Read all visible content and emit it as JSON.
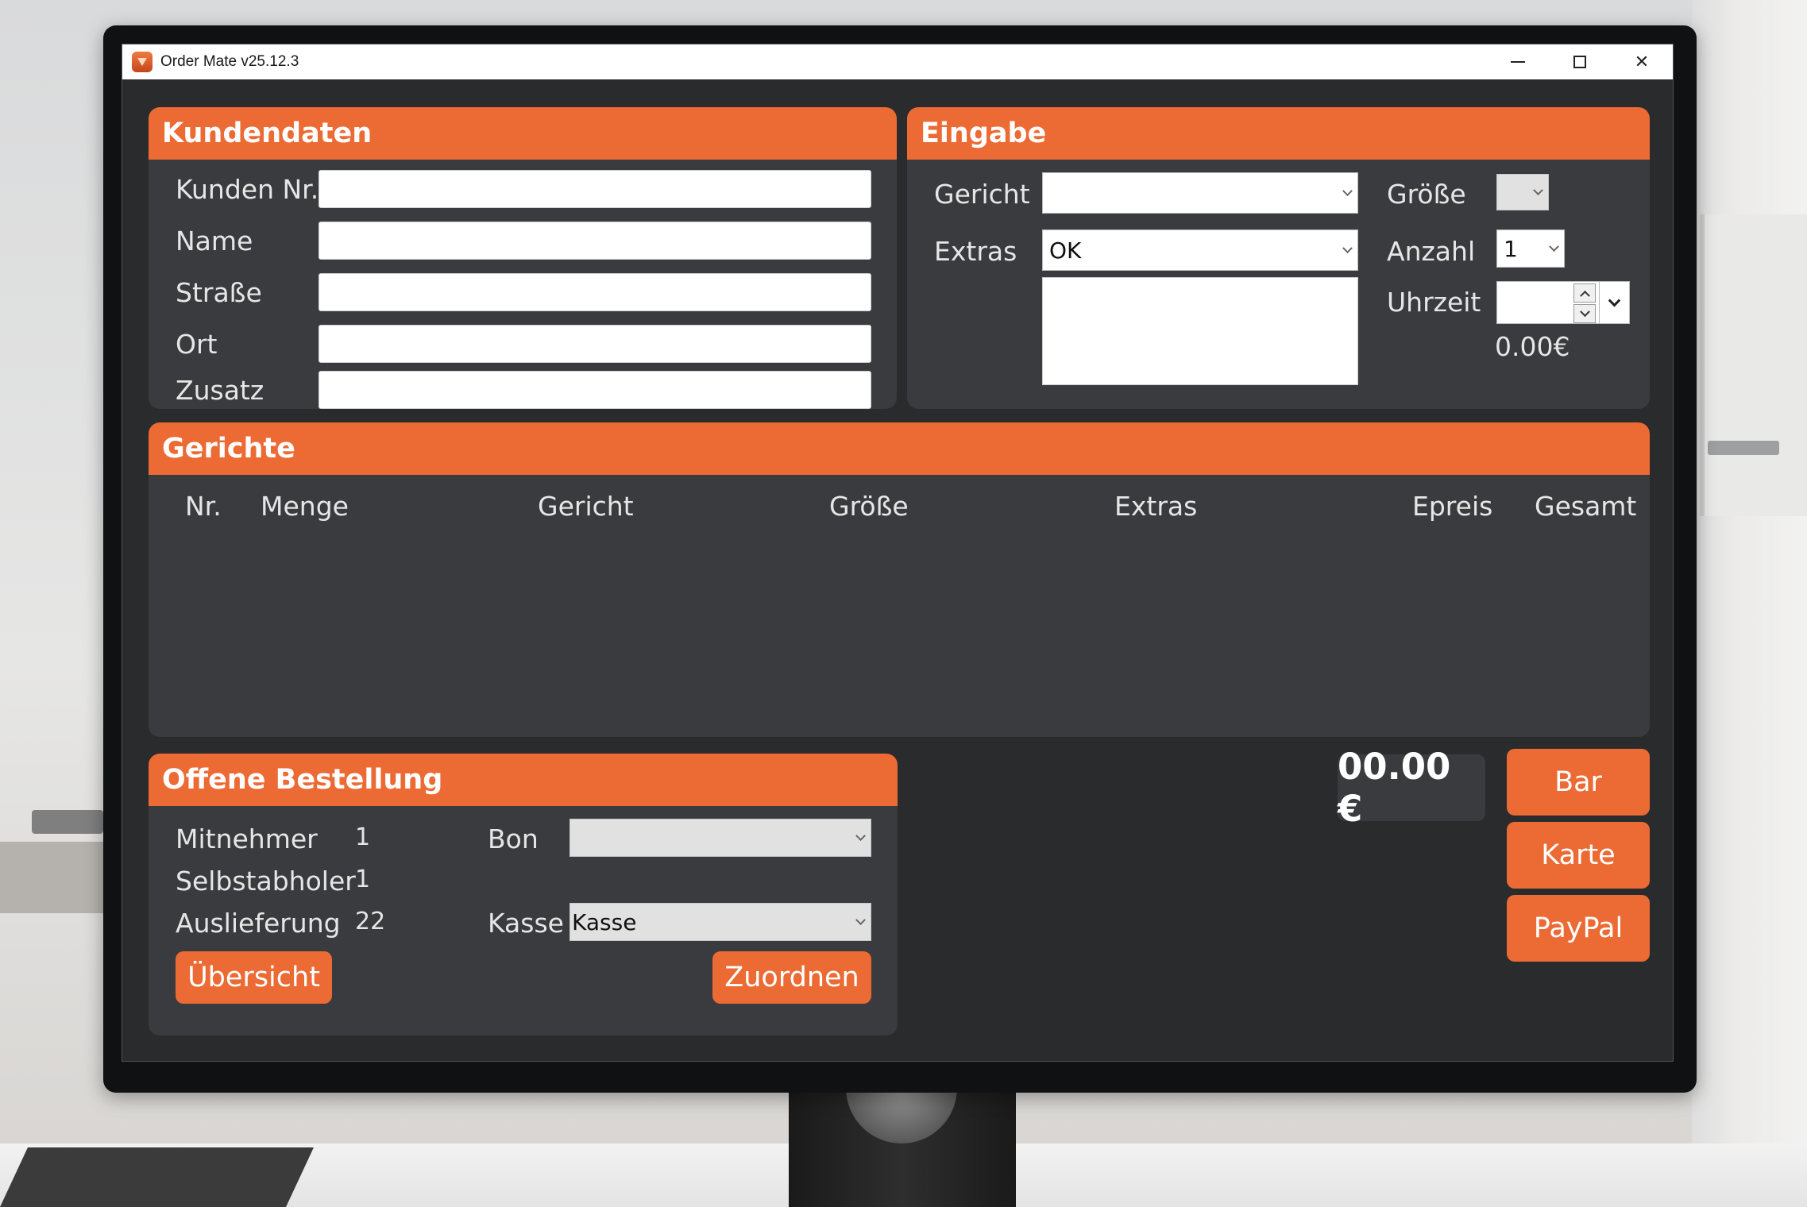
{
  "window": {
    "title": "Order Mate v25.12.3"
  },
  "colors": {
    "accent": "#ec6a34",
    "panel": "#3a3b3f",
    "background": "#2a2b2d"
  },
  "kundendaten": {
    "header": "Kundendaten",
    "fields": [
      {
        "label": "Kunden Nr.",
        "value": ""
      },
      {
        "label": "Name",
        "value": ""
      },
      {
        "label": "Straße",
        "value": ""
      },
      {
        "label": "Ort",
        "value": ""
      },
      {
        "label": "Zusatz",
        "value": ""
      }
    ]
  },
  "eingabe": {
    "header": "Eingabe",
    "gericht_label": "Gericht",
    "gericht_value": "",
    "extras_label": "Extras",
    "extras_value": "OK",
    "extras_notes": "",
    "groesse_label": "Größe",
    "groesse_value": "",
    "anzahl_label": "Anzahl",
    "anzahl_value": "1",
    "uhrzeit_label": "Uhrzeit",
    "uhrzeit_value": "",
    "price": "0.00€"
  },
  "gerichte": {
    "header": "Gerichte",
    "columns": [
      "Nr.",
      "Menge",
      "Gericht",
      "Größe",
      "Extras",
      "Epreis",
      "Gesamt"
    ],
    "rows": []
  },
  "offene_bestellung": {
    "header": "Offene Bestellung",
    "mitnehmer_label": "Mitnehmer",
    "mitnehmer_value": "1",
    "selbstabholer_label": "Selbstabholer",
    "selbstabholer_value": "1",
    "auslieferung_label": "Auslieferung",
    "auslieferung_value": "22",
    "bon_label": "Bon",
    "bon_value": "",
    "kasse_label": "Kasse",
    "kasse_value": "Kasse",
    "uebersicht_button": "Übersicht",
    "zuordnen_button": "Zuordnen"
  },
  "payment": {
    "total": "00.00 €",
    "bar_button": "Bar",
    "karte_button": "Karte",
    "paypal_button": "PayPal"
  }
}
